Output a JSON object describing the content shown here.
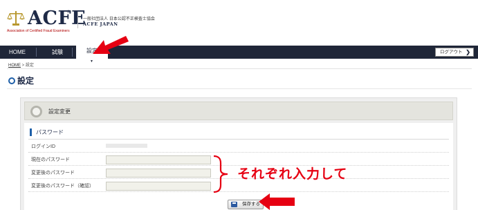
{
  "brand": {
    "name": "ACFE",
    "registered": "®",
    "tagline": "Association of Certified Fraud Examiners",
    "org_jp": "一般社団法人 日本公認不正検査士協会",
    "org_en": "ACFE JAPAN"
  },
  "nav": {
    "items": [
      {
        "label": "HOME"
      },
      {
        "label": "試験"
      },
      {
        "label": "設定",
        "active": true
      }
    ],
    "logout_label": "ログアウト",
    "logout_chevron": "❯"
  },
  "breadcrumb": {
    "home": "HOME",
    "sep": ">",
    "current": "設定"
  },
  "page": {
    "title": "設定"
  },
  "panel": {
    "title": "設定変更",
    "section_title": "パスワード",
    "rows": [
      {
        "label": "ログインID"
      },
      {
        "label": "現在のパスワード",
        "value": ""
      },
      {
        "label": "変更後のパスワード",
        "value": ""
      },
      {
        "label": "変更後のパスワード（確認）",
        "value": ""
      }
    ],
    "save_label": "保存する"
  },
  "annotation": {
    "text": "それぞれ入力して",
    "color": "#e60012"
  },
  "colors": {
    "nav_bg": "#1f2638",
    "brand_navy": "#1e2a47",
    "accent_blue": "#1e5fa8",
    "annotation_red": "#e60012"
  }
}
